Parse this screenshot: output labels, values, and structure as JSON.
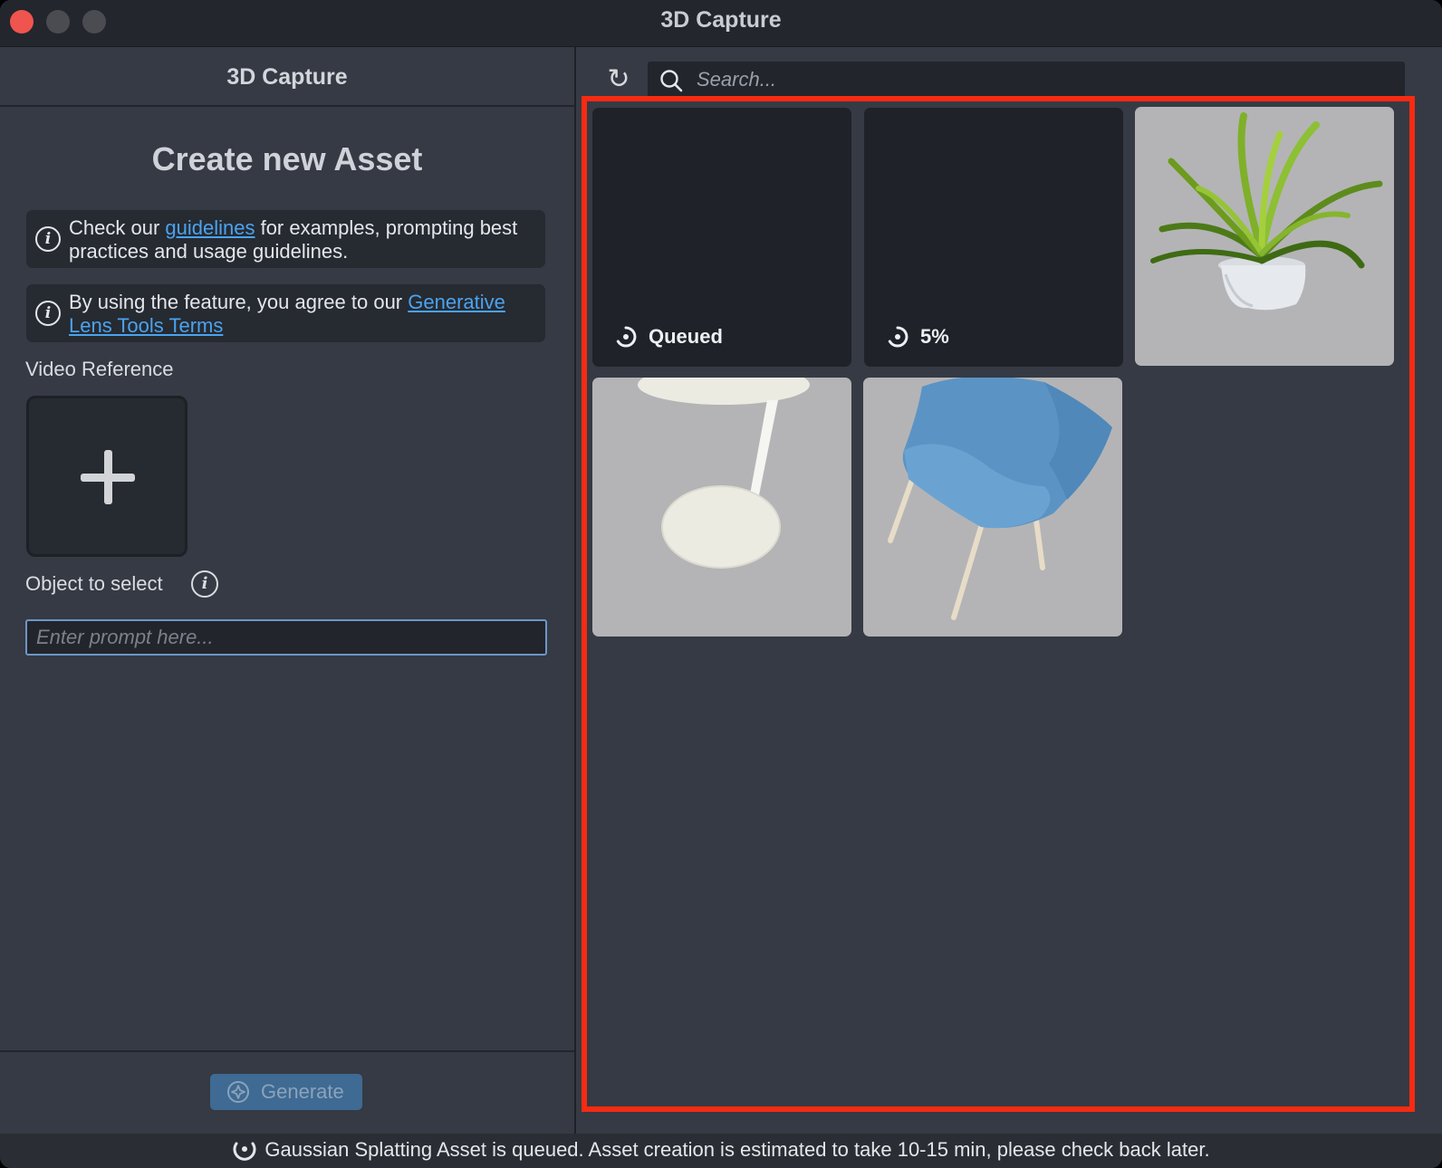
{
  "window": {
    "title": "3D Capture"
  },
  "left_panel": {
    "header": "3D Capture",
    "heading": "Create new Asset",
    "notice_guidelines": {
      "prefix": "Check our ",
      "link": "guidelines",
      "suffix": " for examples, prompting best practices and usage guidelines."
    },
    "notice_terms": {
      "prefix": "By using the feature, you agree to our ",
      "link": "Generative Lens Tools Terms"
    },
    "video_reference_label": "Video Reference",
    "object_label": "Object to select",
    "prompt_placeholder": "Enter prompt here...",
    "generate_label": "Generate"
  },
  "right_panel": {
    "search_placeholder": "Search...",
    "assets": [
      {
        "status": "Queued",
        "kind": "pending"
      },
      {
        "status": "5%",
        "kind": "progress",
        "progress_percent": 5
      },
      {
        "kind": "thumbnail",
        "thumbnail": "potted-plant"
      },
      {
        "kind": "thumbnail",
        "thumbnail": "side-table"
      },
      {
        "kind": "thumbnail",
        "thumbnail": "blue-chair"
      }
    ]
  },
  "status_bar": {
    "icon": "spinner-icon",
    "message": "Gaussian Splatting Asset is queued. Asset creation is estimated to take 10-15 min, please check back later."
  },
  "colors": {
    "highlight_frame": "#f62b12",
    "link": "#4aa3f0",
    "close_button": "#f0544f"
  }
}
